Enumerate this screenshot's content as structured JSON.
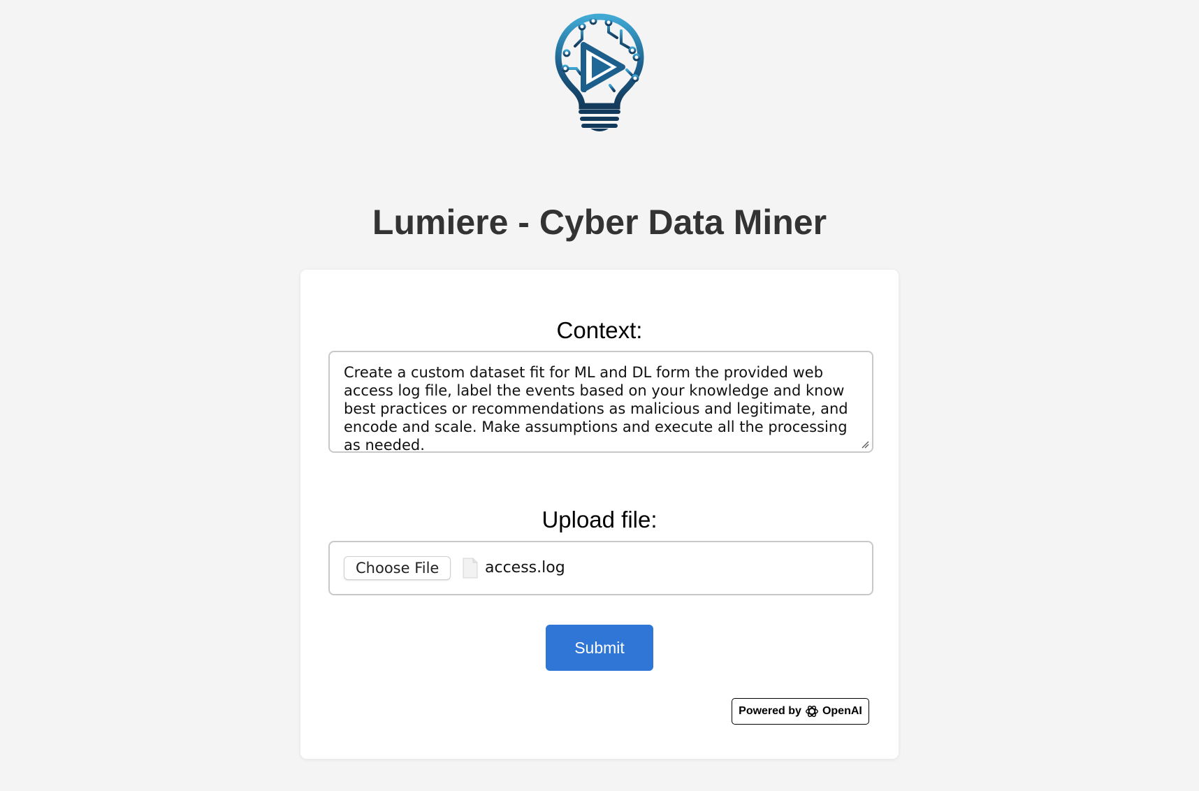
{
  "app": {
    "title": "Lumiere - Cyber Data Miner",
    "logo_icon": "lightbulb-circuit-play-icon"
  },
  "form": {
    "context_label": "Context:",
    "context_value": "Create a custom dataset fit for ML and DL form the provided web access log file, label the events based on your knowledge and know best practices or recommendations as malicious and legitimate, and encode and scale. Make assumptions and execute all the processing as needed.",
    "upload_label": "Upload file:",
    "choose_file_label": "Choose File",
    "file_name": "access.log",
    "submit_label": "Submit"
  },
  "footer": {
    "powered_by": "Powered by",
    "brand": "OpenAI",
    "brand_icon": "openai-icon"
  },
  "colors": {
    "page_bg": "#f4f4f4",
    "accent": "#2f76d6",
    "title": "#333333"
  }
}
